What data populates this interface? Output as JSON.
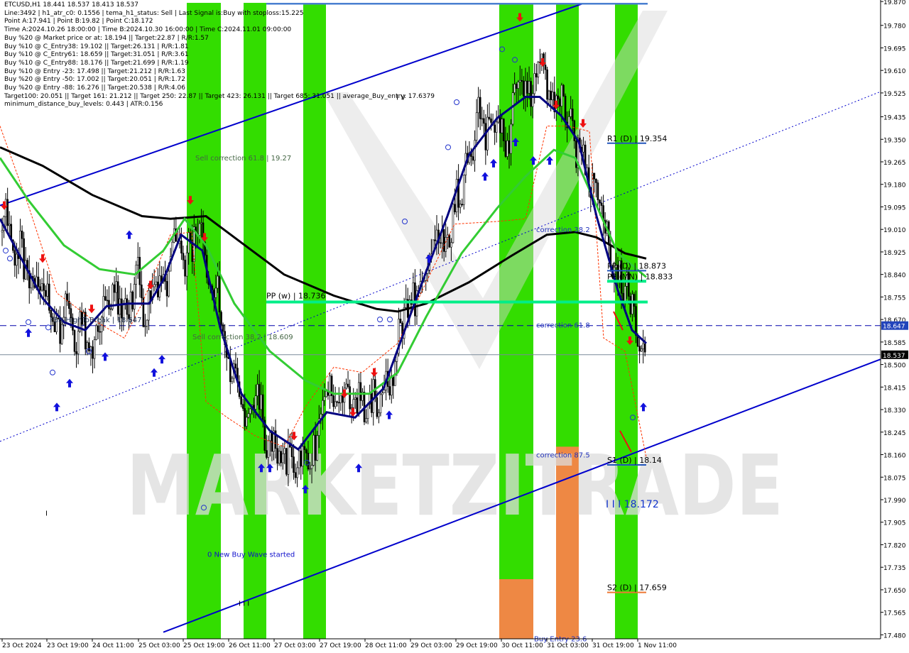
{
  "window": {
    "title": "ETCUSD,H1",
    "ohlc": "18.441 18.537 18.413 18.537"
  },
  "info_lines": [
    "Line:3492 | h1_atr_c0: 0.1556 | tema_h1_status: Sell | Last Signal is:Buy with stoploss:15.225",
    "Point A:17.941 | Point B:19.82 | Point C:18.172",
    "Time A:2024.10.26 18:00:00 | Time B:2024.10.30 16:00:00 | Time C:2024.11.01 09:00:00",
    "Buy %20 @ Market price or at: 18.194 || Target:22.87 | R/R:1.57",
    "Buy %10 @ C_Entry38: 19.102 || Target:26.131 | R/R:1.81",
    "Buy %10 @ C_Entry61: 18.659 || Target:31.051 | R/R:3.61",
    "Buy %10 @ C_Entry88: 18.176 || Target:21.699 | R/R:1.19",
    "Buy %10 @ Entry -23: 17.498 || Target:21.212 | R/R:1.63",
    "Buy %20 @ Entry -50: 17.002 || Target:20.051 | R/R:1.72",
    "Buy %20 @ Entry -88: 16.276 || Target:20.538 | R/R:4.06",
    "Target100: 20.051 || Target 161: 21.212 || Target 250: 22.87 || Target 423: 26.131 || Target 685: 31.051 || average_Buy_entry: 17.6379",
    "minimum_distance_buy_levels: 0.443 | ATR:0.156"
  ],
  "colors": {
    "up_candle": "#000000",
    "down_candle": "#000000",
    "green_zone": "#33dd00",
    "orange_zone": "#ee8844",
    "channel": "#0000cc",
    "ema_fast": "#000080",
    "ema_mid": "#33cc33",
    "ema_slow": "#000000",
    "pivot": "#00ee88",
    "dashed_level": "#0000aa",
    "current_price": "#7a8a99",
    "arrow_buy": "#1111dd",
    "arrow_sell": "#ee1111",
    "stop_line": "#ff3300",
    "watermark": "#dcdcdc"
  },
  "watermark": "MARKETZITRADE",
  "chart_data": {
    "type": "candlestick",
    "symbol": "ETCUSD",
    "timeframe": "H1",
    "y_range": [
      17.465,
      19.865
    ],
    "y_ticks": [
      "19.870",
      "19.780",
      "19.695",
      "19.610",
      "19.525",
      "19.435",
      "19.350",
      "19.265",
      "19.180",
      "19.095",
      "19.010",
      "18.925",
      "18.840",
      "18.755",
      "18.670",
      "18.585",
      "18.500",
      "18.415",
      "18.330",
      "18.245",
      "18.160",
      "18.075",
      "17.990",
      "17.905",
      "17.820",
      "17.735",
      "17.650",
      "17.565",
      "17.480"
    ],
    "x_labels": [
      "23 Oct 2024",
      "23 Oct 19:00",
      "24 Oct 11:00",
      "25 Oct 03:00",
      "25 Oct 19:00",
      "26 Oct 11:00",
      "27 Oct 03:00",
      "27 Oct 19:00",
      "28 Oct 11:00",
      "29 Oct 03:00",
      "29 Oct 19:00",
      "30 Oct 11:00",
      "31 Oct 03:00",
      "31 Oct 19:00",
      "1 Nov 11:00"
    ],
    "current_price": "18.537",
    "dashed_price": "18.647",
    "green_zones": [
      [
        263,
        311
      ],
      [
        343,
        375
      ],
      [
        427,
        459
      ],
      [
        703,
        751
      ],
      [
        783,
        815
      ],
      [
        866,
        898
      ]
    ],
    "orange_zones": [
      [
        703,
        751,
        17.69
      ],
      [
        783,
        815,
        18.19
      ]
    ],
    "channel_upper": [
      [
        0,
        19.1
      ],
      [
        840,
        19.88
      ]
    ],
    "channel_lower": [
      [
        230,
        17.49
      ],
      [
        1240,
        18.52
      ]
    ],
    "dotted_trend": [
      [
        0,
        18.21
      ],
      [
        1240,
        19.53
      ]
    ],
    "ema_slow": [
      [
        0,
        19.32
      ],
      [
        60,
        19.25
      ],
      [
        130,
        19.14
      ],
      [
        200,
        19.06
      ],
      [
        240,
        19.05
      ],
      [
        290,
        19.06
      ],
      [
        340,
        18.96
      ],
      [
        400,
        18.84
      ],
      [
        470,
        18.76
      ],
      [
        530,
        18.71
      ],
      [
        560,
        18.7
      ],
      [
        600,
        18.73
      ],
      [
        660,
        18.81
      ],
      [
        720,
        18.91
      ],
      [
        770,
        18.99
      ],
      [
        810,
        19.0
      ],
      [
        840,
        18.98
      ],
      [
        880,
        18.92
      ],
      [
        910,
        18.9
      ]
    ],
    "ema_mid": [
      [
        0,
        19.28
      ],
      [
        40,
        19.12
      ],
      [
        90,
        18.95
      ],
      [
        140,
        18.86
      ],
      [
        190,
        18.84
      ],
      [
        230,
        18.93
      ],
      [
        260,
        19.05
      ],
      [
        290,
        18.95
      ],
      [
        330,
        18.73
      ],
      [
        380,
        18.55
      ],
      [
        430,
        18.44
      ],
      [
        470,
        18.39
      ],
      [
        520,
        18.39
      ],
      [
        560,
        18.47
      ],
      [
        600,
        18.68
      ],
      [
        650,
        18.92
      ],
      [
        700,
        19.09
      ],
      [
        740,
        19.21
      ],
      [
        780,
        19.31
      ],
      [
        810,
        19.28
      ],
      [
        840,
        19.1
      ],
      [
        870,
        18.92
      ],
      [
        910,
        18.83
      ]
    ],
    "ema_fast": [
      [
        0,
        19.05
      ],
      [
        30,
        18.9
      ],
      [
        60,
        18.75
      ],
      [
        90,
        18.66
      ],
      [
        120,
        18.63
      ],
      [
        150,
        18.72
      ],
      [
        180,
        18.73
      ],
      [
        210,
        18.73
      ],
      [
        230,
        18.82
      ],
      [
        255,
        18.99
      ],
      [
        285,
        18.93
      ],
      [
        310,
        18.64
      ],
      [
        340,
        18.39
      ],
      [
        380,
        18.25
      ],
      [
        420,
        18.18
      ],
      [
        460,
        18.32
      ],
      [
        500,
        18.3
      ],
      [
        540,
        18.41
      ],
      [
        570,
        18.63
      ],
      [
        600,
        18.85
      ],
      [
        630,
        19.06
      ],
      [
        660,
        19.29
      ],
      [
        700,
        19.43
      ],
      [
        740,
        19.51
      ],
      [
        760,
        19.51
      ],
      [
        790,
        19.44
      ],
      [
        815,
        19.34
      ],
      [
        840,
        19.06
      ],
      [
        870,
        18.78
      ],
      [
        890,
        18.63
      ],
      [
        910,
        18.58
      ]
    ],
    "stop_line": [
      [
        0,
        19.4
      ],
      [
        40,
        19.1
      ],
      [
        80,
        18.77
      ],
      [
        130,
        18.67
      ],
      [
        175,
        18.6
      ],
      [
        200,
        18.73
      ],
      [
        240,
        18.99
      ],
      [
        270,
        19.0
      ],
      [
        290,
        18.36
      ],
      [
        320,
        18.3
      ],
      [
        360,
        18.23
      ],
      [
        400,
        18.19
      ],
      [
        430,
        18.34
      ],
      [
        470,
        18.49
      ],
      [
        510,
        18.47
      ],
      [
        560,
        18.58
      ],
      [
        600,
        18.81
      ],
      [
        640,
        19.03
      ],
      [
        700,
        19.04
      ],
      [
        740,
        19.05
      ],
      [
        770,
        19.4
      ],
      [
        800,
        19.4
      ],
      [
        830,
        19.38
      ],
      [
        850,
        18.6
      ],
      [
        880,
        18.55
      ],
      [
        910,
        18.15
      ]
    ],
    "candles_seed": 3492,
    "levels": [
      {
        "label": "R1 (D) | 19.354",
        "price": 19.354,
        "x1": 855,
        "x2": 910,
        "color": "#2255bb"
      },
      {
        "label": "PP (D) | 18.873",
        "price": 18.873,
        "x1": 855,
        "x2": 910,
        "color": "#2255bb"
      },
      {
        "label": "PP (MN) | 18.833",
        "price": 18.833,
        "x1": 855,
        "x2": 910,
        "color": "#00ee88"
      },
      {
        "label": "S1 (D) | 18.14",
        "price": 18.14,
        "x1": 855,
        "x2": 910,
        "color": "#2255bb"
      },
      {
        "label": "S2 (D) | 17.659",
        "price": 17.659,
        "x1": 855,
        "x2": 910,
        "color": "#ee7733"
      }
    ],
    "pivot_week": {
      "label": "PP (w) | 18.736",
      "price": 18.736,
      "x1": 375,
      "x2": 912
    },
    "annotations": [
      {
        "text": "Sell correction 61.8 | 19.27",
        "x": 275,
        "price": 19.27,
        "color": "#446644"
      },
      {
        "text": "Sell correction 38.2 | 18.609",
        "x": 271,
        "price": 18.595,
        "color": "#446644"
      },
      {
        "text": "FSB-HighToBreak | 18.647",
        "x": 70,
        "price": 18.66,
        "color": "#223355"
      },
      {
        "text": "correction 38.2",
        "x": 755,
        "price": 19.0,
        "color": "#2233bb"
      },
      {
        "text": "correction 61.8",
        "x": 755,
        "price": 18.64,
        "color": "#2233bb"
      },
      {
        "text": "correction 87.5",
        "x": 755,
        "price": 18.15,
        "color": "#2233bb"
      },
      {
        "text": "0 New Buy Wave started",
        "x": 292,
        "price": 17.775,
        "color": "#1111cc"
      },
      {
        "text": "I V",
        "x": 558,
        "price": 19.5,
        "color": "#000000"
      },
      {
        "text": "I I I 18.172",
        "x": 853,
        "price": 17.96,
        "color": "#1133cc",
        "size": 14
      },
      {
        "text": "I",
        "x": 64,
        "price": 17.93,
        "color": "#000000"
      },
      {
        "text": "I I I",
        "x": 336,
        "price": 17.59,
        "color": "#000000"
      },
      {
        "text": "Buy Entry 23.6",
        "x": 752,
        "price": 17.455,
        "color": "#2233bb"
      }
    ],
    "buy_arrows": [
      [
        40,
        18.62
      ],
      [
        80,
        18.34
      ],
      [
        98,
        18.43
      ],
      [
        148,
        18.53
      ],
      [
        182,
        18.99
      ],
      [
        217,
        18.47
      ],
      [
        228,
        18.52
      ],
      [
        368,
        18.11
      ],
      [
        380,
        18.11
      ],
      [
        430,
        18.03
      ],
      [
        505,
        18.11
      ],
      [
        548,
        18.31
      ],
      [
        604,
        18.9
      ],
      [
        683,
        19.21
      ],
      [
        695,
        19.26
      ],
      [
        726,
        19.34
      ],
      [
        751,
        19.27
      ],
      [
        774,
        19.27
      ],
      [
        906,
        18.34
      ]
    ],
    "sell_arrows": [
      [
        6,
        19.1
      ],
      [
        60,
        18.9
      ],
      [
        129,
        18.71
      ],
      [
        212,
        18.8
      ],
      [
        268,
        19.12
      ],
      [
        288,
        18.98
      ],
      [
        414,
        18.23
      ],
      [
        485,
        18.39
      ],
      [
        497,
        18.32
      ],
      [
        527,
        18.47
      ],
      [
        732,
        19.81
      ],
      [
        764,
        19.64
      ],
      [
        783,
        19.48
      ],
      [
        821,
        19.41
      ],
      [
        887,
        18.59
      ]
    ],
    "circle_marks": [
      [
        8,
        18.93
      ],
      [
        14,
        18.9
      ],
      [
        40,
        18.66
      ],
      [
        68,
        18.64
      ],
      [
        74,
        18.47
      ],
      [
        125,
        18.55
      ],
      [
        287,
        17.96
      ],
      [
        432,
        18.13
      ],
      [
        535,
        18.67
      ],
      [
        549,
        18.67
      ],
      [
        570,
        19.04
      ],
      [
        643,
        19.49
      ],
      [
        631,
        19.32
      ],
      [
        707,
        19.69
      ],
      [
        725,
        19.65
      ],
      [
        891,
        18.3
      ]
    ]
  }
}
